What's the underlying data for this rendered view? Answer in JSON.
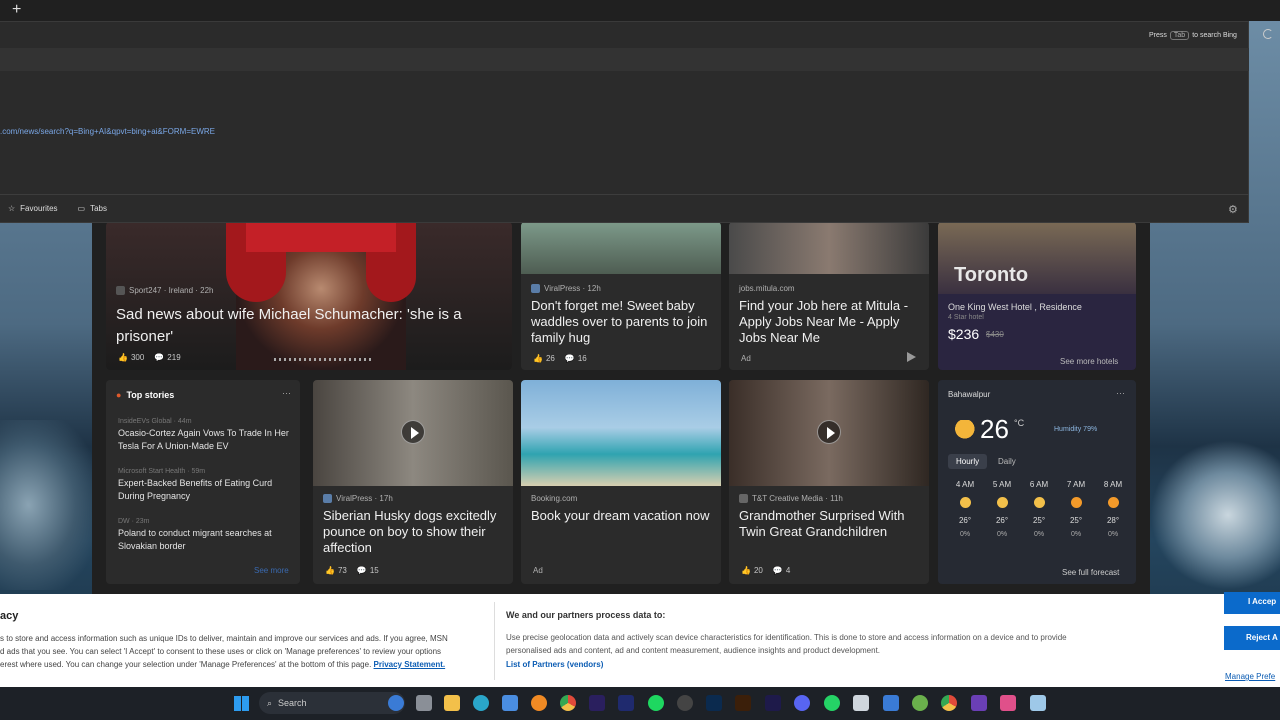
{
  "topbar": {
    "new_tab": "+"
  },
  "searchpanel": {
    "hint_prefix": "Press",
    "hint_key": "Tab",
    "hint_suffix": "to search Bing",
    "url": ".com/news/search?q=Bing+AI&qpvt=bing+ai&FORM=EWRE",
    "favourites": "Favourites",
    "tabs": "Tabs"
  },
  "hero": {
    "source": "Sport247 · Ireland · 22h",
    "title": "Sad news about wife Michael Schumacher: 'she is a prisoner'",
    "likes": "300",
    "comments": "219"
  },
  "cards_top": [
    {
      "source": "ViralPress · 12h",
      "title": "Don't forget me! Sweet baby waddles over to parents to join family hug",
      "likes": "26",
      "comments": "16"
    },
    {
      "source": "jobs.mitula.com",
      "title": "Find your Job here at Mitula - Apply Jobs Near Me - Apply Jobs Near Me",
      "ad": "Ad"
    }
  ],
  "hotel": {
    "city": "Toronto",
    "name": "One King West Hotel , Residence",
    "stars": "4 Star hotel",
    "price": "$236",
    "old_price": "$430",
    "more": "See more hotels"
  },
  "topstories": {
    "title": "Top stories",
    "items": [
      {
        "source": "InsideEVs Global · 44m",
        "title": "Ocasio-Cortez Again Vows To Trade In Her Tesla For A Union-Made EV"
      },
      {
        "source": "Microsoft Start Health · 59m",
        "title": "Expert-Backed Benefits of Eating Curd During Pregnancy"
      },
      {
        "source": "DW · 23m",
        "title": "Poland to conduct migrant searches at Slovakian border"
      }
    ],
    "see_more": "See more"
  },
  "cards_bottom": [
    {
      "source": "ViralPress · 17h",
      "title": "Siberian Husky dogs excitedly pounce on boy to show their affection",
      "likes": "73",
      "comments": "15"
    },
    {
      "source": "Booking.com",
      "title": "Book your dream vacation now",
      "ad": "Ad"
    },
    {
      "source": "T&T Creative Media · 11h",
      "title": "Grandmother Surprised With Twin Great Grandchildren",
      "likes": "20",
      "comments": "4"
    }
  ],
  "weather": {
    "location": "Bahawalpur",
    "temp": "26",
    "unit": "°C",
    "humidity": "Humidity 79%",
    "tab_hourly": "Hourly",
    "tab_daily": "Daily",
    "see_forecast": "See full forecast",
    "hours": [
      {
        "time": "4 AM",
        "temp": "26°",
        "precip": "0%"
      },
      {
        "time": "5 AM",
        "temp": "26°",
        "precip": "0%"
      },
      {
        "time": "6 AM",
        "temp": "25°",
        "precip": "0%"
      },
      {
        "time": "7 AM",
        "temp": "25°",
        "precip": "0%"
      },
      {
        "time": "8 AM",
        "temp": "28°",
        "precip": "0%"
      }
    ]
  },
  "cookie": {
    "title": "acy",
    "text1": "s to store and access information such as unique IDs to deliver, maintain and improve our services and ads. If you agree, MSN",
    "text2": "d ads that you see. You can select 'I Accept' to consent to these uses or click on 'Manage preferences' to review your options",
    "text3": "erest where used. You can change your selection under 'Manage Preferences' at the bottom of this page.",
    "privacy": "Privacy Statement.",
    "partners_title": "We and our partners process data to:",
    "partners_text1": "Use precise geolocation data and actively scan device characteristics for identification. This is done to store and access information on a device and to provide",
    "partners_text2": "personalised ads and content, ad and content measurement, audience insights and product development.",
    "partners_link": "List of Partners (vendors)",
    "accept": "I Accep",
    "reject": "Reject A",
    "manage": "Manage Prefe"
  },
  "taskbar": {
    "search": "Search"
  }
}
